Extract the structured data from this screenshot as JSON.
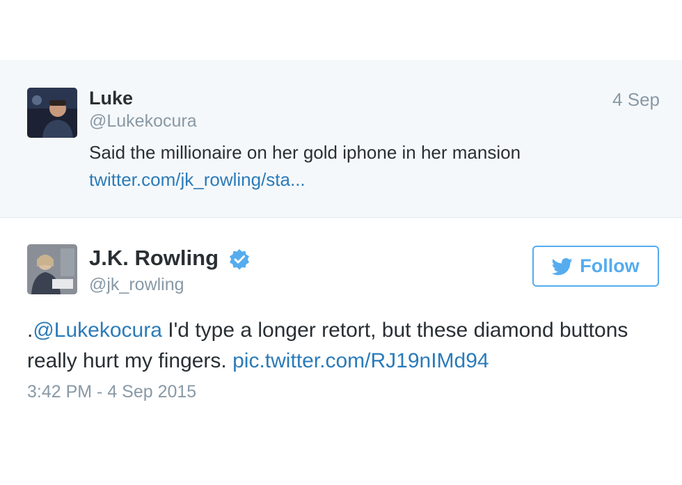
{
  "reply": {
    "name": "Luke",
    "handle": "@Lukekocura",
    "date": "4 Sep",
    "text": "Said the millionaire on her gold iphone in her mansion",
    "link": "twitter.com/jk_rowling/sta..."
  },
  "main_tweet": {
    "name": "J.K. Rowling",
    "handle": "@jk_rowling",
    "follow_label": "Follow",
    "text_prefix": ".",
    "mention": "@Lukekocura",
    "text_body": " I'd type a longer retort, but these diamond buttons really hurt my fingers. ",
    "pic_link": "pic.twitter.com/RJ19nIMd94",
    "timestamp": "3:42 PM - 4 Sep 2015",
    "verified_icon": "verified-badge-icon",
    "follow_icon": "twitter-bird-icon"
  },
  "colors": {
    "link": "#2b7bb9",
    "follow": "#55acee",
    "muted": "#8899a6",
    "reply_bg": "#f5f8fa"
  }
}
